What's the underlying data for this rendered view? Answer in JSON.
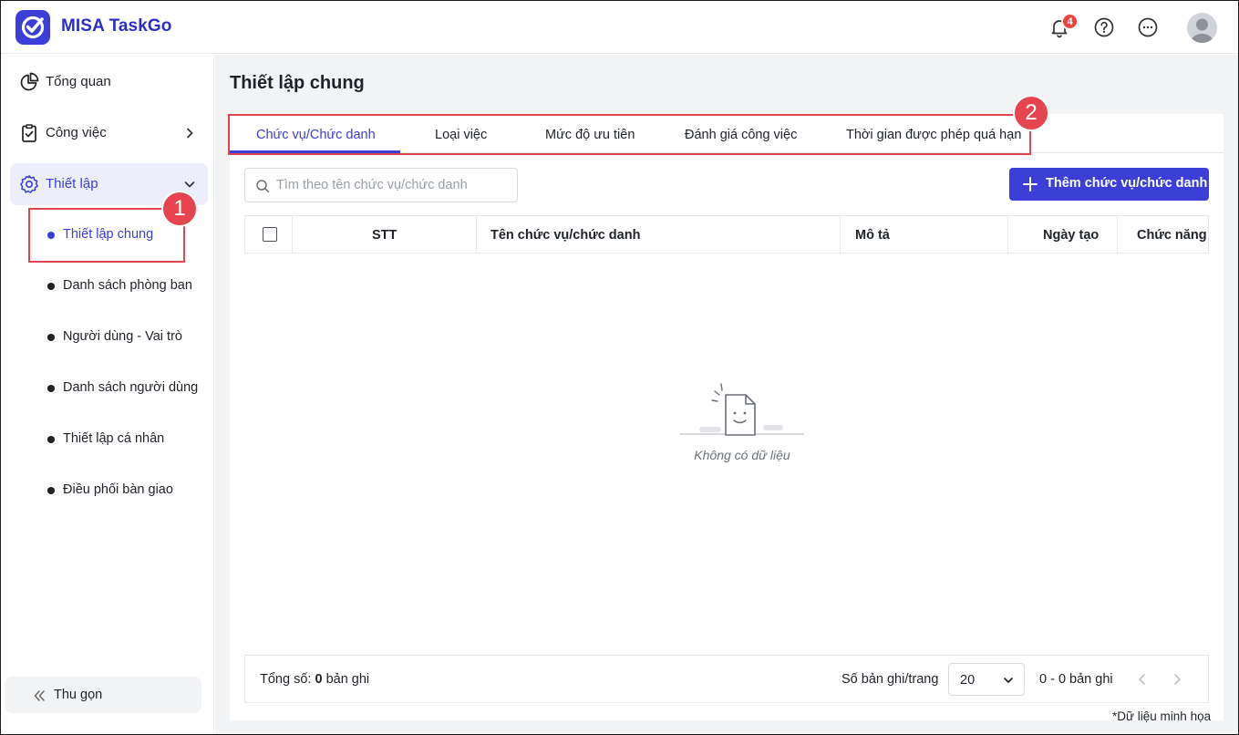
{
  "app": {
    "title": "MISA TaskGo",
    "notification_count": "4"
  },
  "colors": {
    "brand": "#3b3fd8",
    "highlight": "#e0454f",
    "badge": "#e8453c"
  },
  "sidebar": {
    "items": [
      {
        "label": "Tổng quan",
        "icon": "pie-chart-icon"
      },
      {
        "label": "Công việc",
        "icon": "clipboard-check-icon"
      },
      {
        "label": "Thiết lập",
        "icon": "gear-icon"
      }
    ],
    "sub_items": [
      {
        "label": "Thiết lập chung"
      },
      {
        "label": "Danh sách phòng ban"
      },
      {
        "label": "Người dùng - Vai trò"
      },
      {
        "label": "Danh sách người dùng"
      },
      {
        "label": "Thiết lập cá nhân"
      },
      {
        "label": "Điều phối bàn giao"
      }
    ],
    "collapse_label": "Thu gọn"
  },
  "main": {
    "page_title": "Thiết lập chung",
    "tabs": [
      {
        "label": "Chức vụ/Chức danh"
      },
      {
        "label": "Loại việc"
      },
      {
        "label": "Mức độ ưu tiên"
      },
      {
        "label": "Đánh giá công việc"
      },
      {
        "label": "Thời gian được phép quá hạn"
      }
    ],
    "search": {
      "placeholder": "Tìm theo tên chức vụ/chức danh",
      "value": ""
    },
    "add_button_label": "Thêm chức vụ/chức danh",
    "table": {
      "columns": [
        "STT",
        "Tên chức vụ/chức danh",
        "Mô tả",
        "Ngày tạo",
        "Chức năng"
      ],
      "rows": []
    },
    "empty_text": "Không có dữ liệu",
    "footer": {
      "total_label": "Tổng số:",
      "total_value": "0",
      "total_unit": "bản ghi",
      "per_page_label": "Số bản ghi/trang",
      "per_page_value": "20",
      "range_text": "0 - 0 bản ghi"
    }
  },
  "annotations": {
    "marker_1": "1",
    "marker_2": "2",
    "note": "*Dữ liệu minh họa"
  }
}
